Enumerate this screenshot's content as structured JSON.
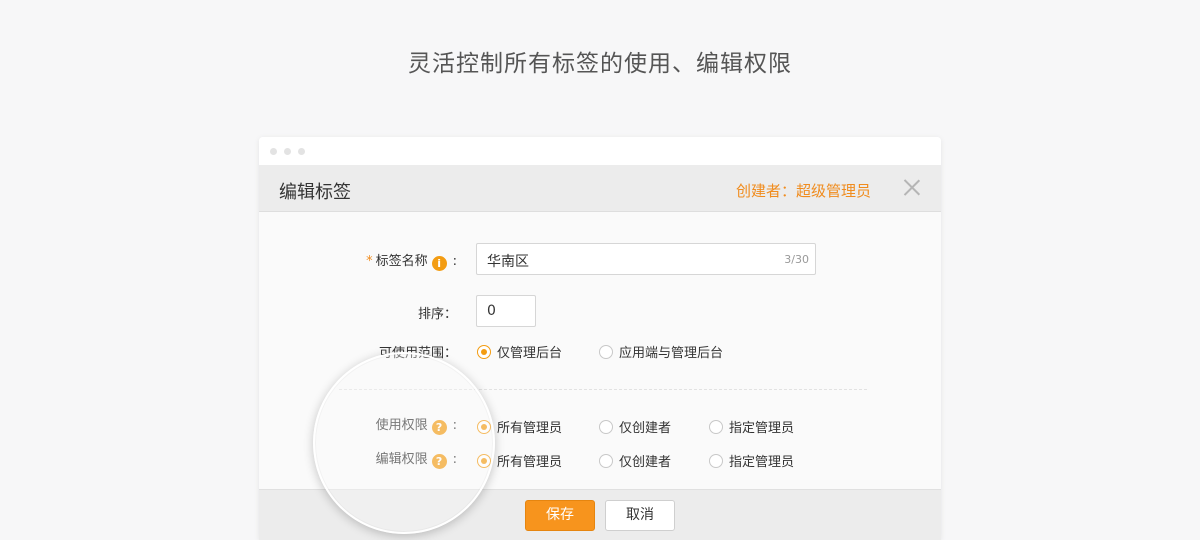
{
  "headline": "灵活控制所有标签的使用、编辑权限",
  "dialog": {
    "title": "编辑标签",
    "creator": "创建者：超级管理员"
  },
  "form": {
    "name": {
      "required_mark": "*",
      "label": "标签名称",
      "info_icon": "i",
      "colon": ":",
      "value": "华南区",
      "count": "3/30"
    },
    "sort": {
      "label": "排序：",
      "value": "0"
    },
    "scope": {
      "label": "可使用范围：",
      "options": [
        "仅管理后台",
        "应用端与管理后台"
      ],
      "selected": "仅管理后台"
    },
    "use_permission": {
      "label": "使用权限",
      "help_icon": "?",
      "colon": ":",
      "options": [
        "所有管理员",
        "仅创建者",
        "指定管理员"
      ],
      "selected": "所有管理员"
    },
    "edit_permission": {
      "label": "编辑权限",
      "help_icon": "?",
      "colon": ":",
      "options": [
        "所有管理员",
        "仅创建者",
        "指定管理员"
      ],
      "selected": "所有管理员"
    }
  },
  "buttons": {
    "save": "保存",
    "cancel": "取消"
  },
  "colors": {
    "accent": "#f39c12",
    "creator_text": "#f08c1e",
    "save_button": "#f7941d"
  },
  "icons": [
    "info-icon",
    "help-icon",
    "close-icon"
  ]
}
